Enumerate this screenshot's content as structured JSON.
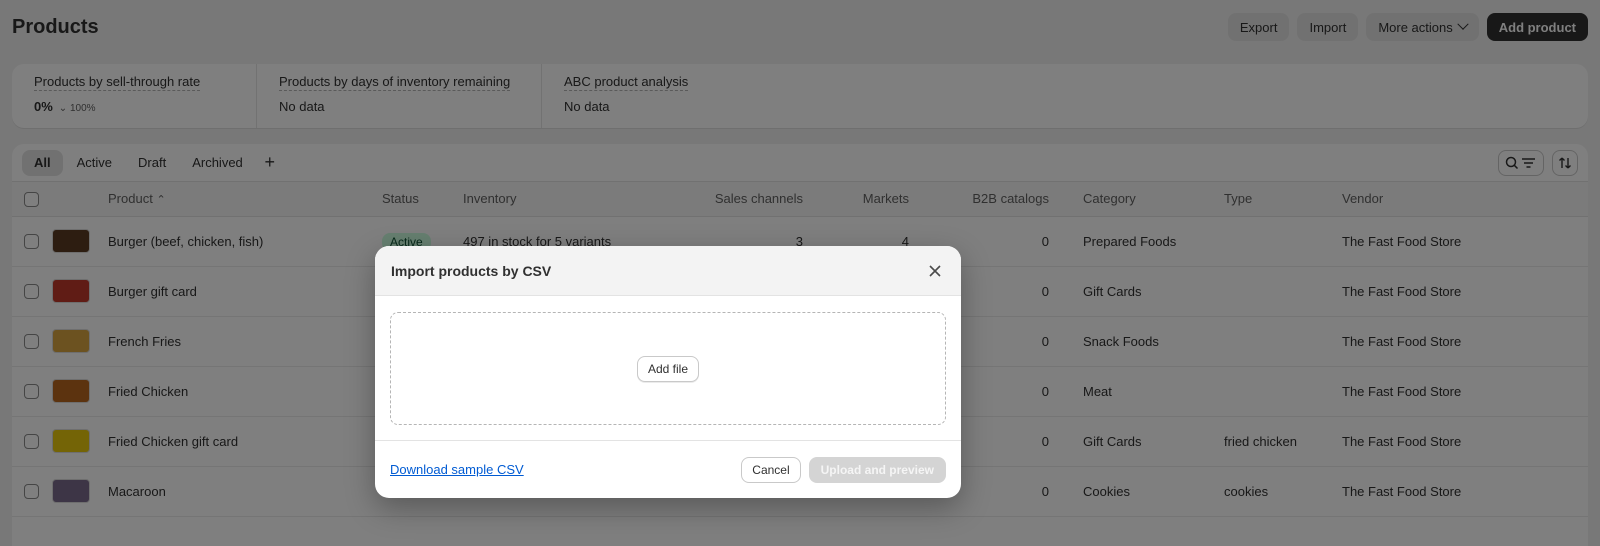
{
  "header": {
    "title": "Products",
    "actions": {
      "export": "Export",
      "import": "Import",
      "more": "More actions",
      "add": "Add product"
    }
  },
  "analytics": [
    {
      "title": "Products by sell-through rate",
      "value": "0%",
      "sub": "⌄ 100%"
    },
    {
      "title": "Products by days of inventory remaining",
      "value": "No data",
      "sub": ""
    },
    {
      "title": "ABC product analysis",
      "value": "No data",
      "sub": ""
    }
  ],
  "tabs": [
    "All",
    "Active",
    "Draft",
    "Archived"
  ],
  "tab_add": "+",
  "table": {
    "headers": {
      "product": "Product",
      "status": "Status",
      "inventory": "Inventory",
      "sales_channels": "Sales channels",
      "markets": "Markets",
      "b2b": "B2B catalogs",
      "category": "Category",
      "type": "Type",
      "vendor": "Vendor"
    },
    "rows": [
      {
        "name": "Burger (beef, chicken, fish)",
        "status": "Active",
        "inventory": "497 in stock for 5 variants",
        "channels": "3",
        "markets": "4",
        "b2b": "0",
        "category": "Prepared Foods",
        "type": "",
        "vendor": "The Fast Food Store",
        "thumb": "#5a3a22"
      },
      {
        "name": "Burger gift card",
        "status": "",
        "inventory": "",
        "channels": "",
        "markets": "",
        "b2b": "0",
        "category": "Gift Cards",
        "type": "",
        "vendor": "The Fast Food Store",
        "thumb": "#c0392b"
      },
      {
        "name": "French Fries",
        "status": "",
        "inventory": "",
        "channels": "",
        "markets": "",
        "b2b": "0",
        "category": "Snack Foods",
        "type": "",
        "vendor": "The Fast Food Store",
        "thumb": "#d9a441"
      },
      {
        "name": "Fried Chicken",
        "status": "",
        "inventory": "",
        "channels": "",
        "markets": "",
        "b2b": "0",
        "category": "Meat",
        "type": "",
        "vendor": "The Fast Food Store",
        "thumb": "#b8661f"
      },
      {
        "name": "Fried Chicken gift card",
        "status": "",
        "inventory": "",
        "channels": "",
        "markets": "",
        "b2b": "0",
        "category": "Gift Cards",
        "type": "fried chicken",
        "vendor": "The Fast Food Store",
        "thumb": "#e9c80d"
      },
      {
        "name": "Macaroon",
        "status": "",
        "inventory": "",
        "channels": "",
        "markets": "",
        "b2b": "0",
        "category": "Cookies",
        "type": "cookies",
        "vendor": "The Fast Food Store",
        "thumb": "#7a6a8c"
      }
    ]
  },
  "modal": {
    "title": "Import products by CSV",
    "add_file": "Add file",
    "download_link": "Download sample CSV",
    "cancel": "Cancel",
    "upload": "Upload and preview"
  },
  "icons": {
    "close": "close-icon",
    "search_filter": "search-filter-icon",
    "sort": "sort-icon",
    "chevron": "chevron-down-icon"
  }
}
